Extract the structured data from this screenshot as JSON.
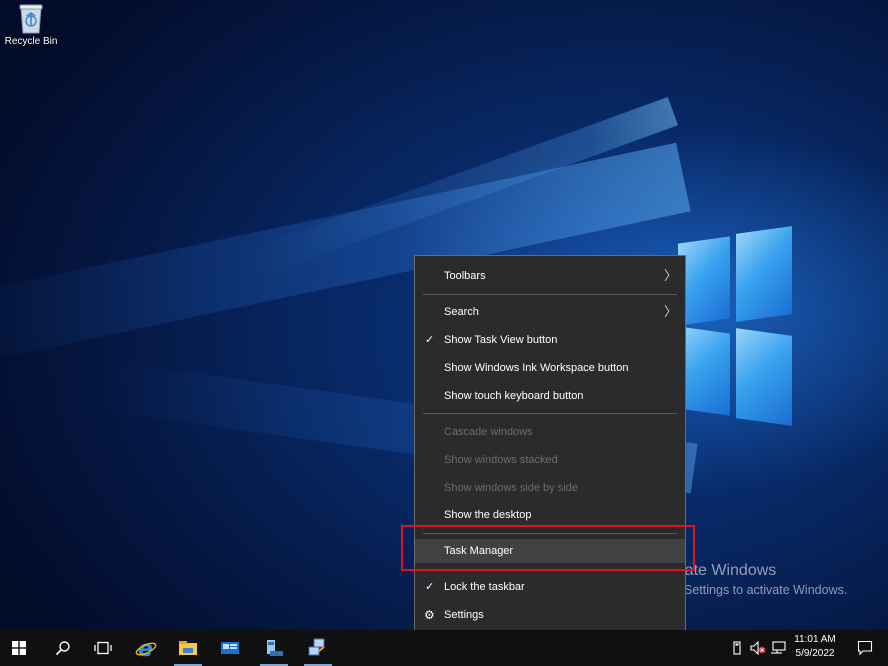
{
  "desktop": {
    "icons": [
      {
        "label": "Recycle Bin",
        "icon": "recycle-bin-icon"
      }
    ],
    "watermark": {
      "line1": "Activate Windows",
      "line2": "Go to Settings to activate Windows."
    }
  },
  "context_menu": {
    "items": [
      {
        "label": "Toolbars",
        "submenu": true
      },
      {
        "label": "Search",
        "submenu": true
      },
      {
        "label": "Show Task View button",
        "checked": true
      },
      {
        "label": "Show Windows Ink Workspace button"
      },
      {
        "label": "Show touch keyboard button"
      },
      {
        "label": "Cascade windows",
        "disabled": true
      },
      {
        "label": "Show windows stacked",
        "disabled": true
      },
      {
        "label": "Show windows side by side",
        "disabled": true
      },
      {
        "label": "Show the desktop"
      },
      {
        "label": "Task Manager",
        "highlighted": true
      },
      {
        "label": "Lock the taskbar",
        "checked": true
      },
      {
        "label": "Settings",
        "icon": "gear-icon"
      }
    ],
    "check_glyph": "✓",
    "arrow_glyph": "〉",
    "gear_glyph": "⚙"
  },
  "highlight_color": "#e0141e",
  "taskbar": {
    "pinned": [
      "start-icon",
      "search-icon",
      "task-view-icon",
      "internet-explorer-icon",
      "file-explorer-icon",
      "server-manager-icon",
      "network-icon",
      "remote-desktop-icon"
    ],
    "tray_icons": [
      "usb-icon",
      "volume-muted-icon",
      "network-tray-icon"
    ],
    "clock": {
      "time": "11:01 AM",
      "date": "5/9/2022"
    },
    "notification_icon": "action-center-icon"
  }
}
